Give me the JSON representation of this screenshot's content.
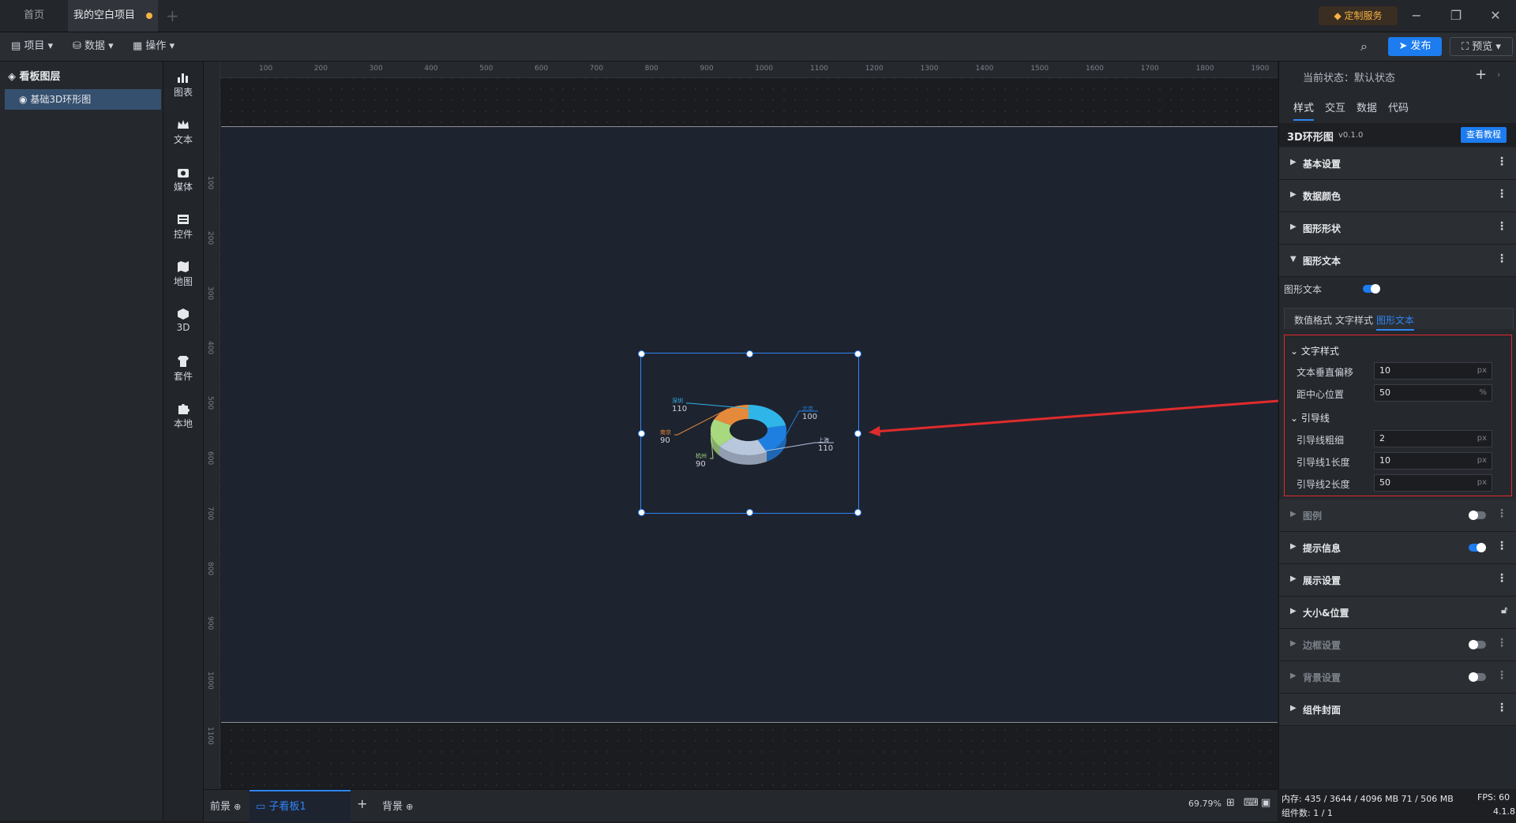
{
  "tabs": {
    "home": "首页",
    "project": "我的空白项目"
  },
  "top": {
    "custom_service": "定制服务"
  },
  "toolbar": {
    "project": "项目",
    "data": "数据",
    "operation": "操作",
    "publish": "发布",
    "preview": "预览"
  },
  "layers": {
    "title": "看板图层",
    "item": "基础3D环形图"
  },
  "components": [
    "图表",
    "文本",
    "媒体",
    "控件",
    "地图",
    "3D",
    "套件",
    "本地"
  ],
  "ruler": {
    "h": [
      "100",
      "200",
      "300",
      "400",
      "500",
      "600",
      "700",
      "800",
      "900",
      "1000",
      "1100",
      "1200",
      "1300",
      "1400",
      "1500",
      "1600",
      "1700",
      "1800",
      "1900"
    ],
    "v": [
      "100",
      "200",
      "300",
      "400",
      "500",
      "600",
      "700",
      "800",
      "900",
      "1000",
      "1100"
    ]
  },
  "chart_data": {
    "type": "pie",
    "categories": [
      "深圳",
      "北京",
      "上海",
      "杭州",
      "南京"
    ],
    "values": [
      110,
      100,
      110,
      90,
      90
    ],
    "colors": [
      "#2fb5e8",
      "#1e7fe0",
      "#b9c7dc",
      "#a8d97e",
      "#e58a3a"
    ]
  },
  "bottom": {
    "front": "前景",
    "board": "子看板1",
    "background": "背景",
    "zoom": "69.79%"
  },
  "panel": {
    "status": "当前状态：默认状态",
    "tabs": [
      "样式",
      "交互",
      "数据",
      "代码"
    ],
    "comp_name": "3D环形图",
    "version": "v0.1.0",
    "tutorial": "查看教程",
    "sections_top": [
      "基本设置",
      "数据颜色",
      "图形形状",
      "图形文本"
    ],
    "text_toggle_label": "图形文本",
    "subtabs": [
      "数值格式",
      "文字样式",
      "图形文本"
    ],
    "text_style": {
      "title": "文字样式",
      "offset_label": "文本垂直偏移",
      "offset_value": "10",
      "offset_unit": "px",
      "center_label": "距中心位置",
      "center_value": "50",
      "center_unit": "%"
    },
    "guide": {
      "title": "引导线",
      "width_label": "引导线粗细",
      "width_value": "2",
      "len1_label": "引导线1长度",
      "len1_value": "10",
      "len2_label": "引导线2长度",
      "len2_value": "50",
      "unit": "px"
    },
    "sections_bottom": [
      "图例",
      "提示信息",
      "展示设置",
      "大小&位置",
      "边框设置",
      "背景设置",
      "组件封面"
    ]
  },
  "footer": {
    "memory": "内存:  435 / 3644 / 4096 MB  71 / 506 MB",
    "fps": "FPS:  60",
    "count": "组件数: 1 / 1",
    "version": "4.1.8"
  }
}
